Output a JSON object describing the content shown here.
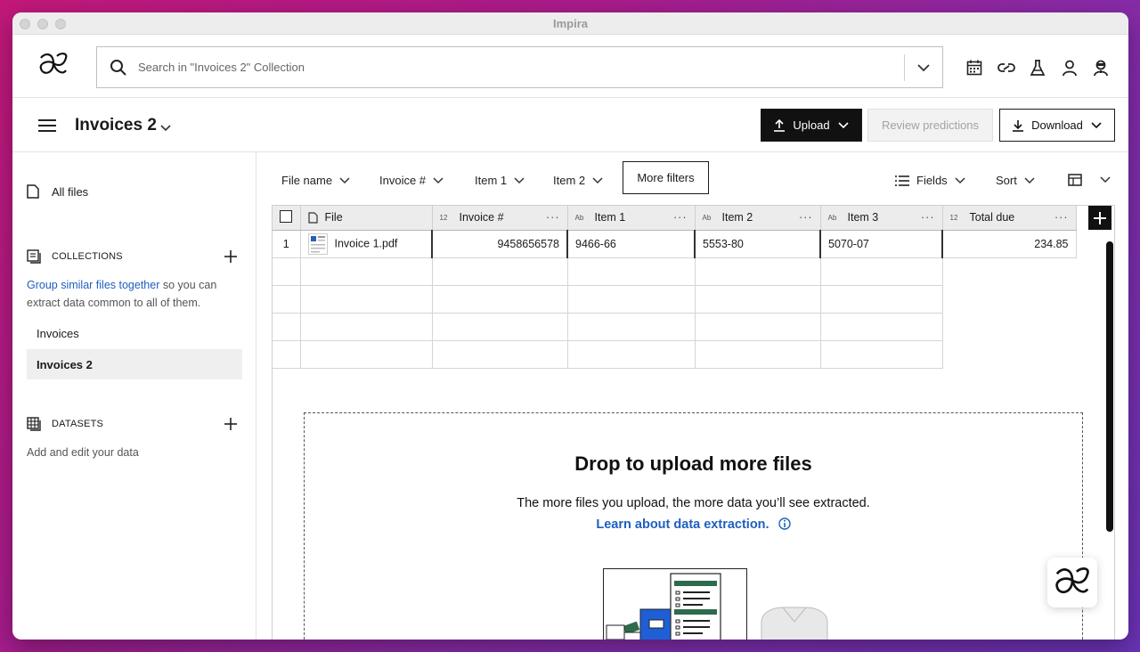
{
  "window": {
    "title": "Impira"
  },
  "search": {
    "placeholder": "Search in \"Invoices 2\" Collection"
  },
  "toolbar_icons": [
    "calendar-icon",
    "link-icon",
    "flask-icon",
    "user-icon",
    "agent-icon"
  ],
  "collection": {
    "title": "Invoices 2"
  },
  "actions": {
    "upload": "Upload",
    "review": "Review predictions",
    "download": "Download"
  },
  "sidebar": {
    "all_files": "All files",
    "collections_label": "COLLECTIONS",
    "collections_help_link": "Group similar files together",
    "collections_help_rest": " so you can extract data common to all of them.",
    "items": [
      {
        "label": "Invoices",
        "active": false
      },
      {
        "label": "Invoices 2",
        "active": true
      }
    ],
    "datasets_label": "DATASETS",
    "datasets_help": "Add and edit your data"
  },
  "filters": {
    "file_name": "File name",
    "invoice": "Invoice #",
    "item1": "Item 1",
    "item2": "Item 2",
    "more": "More filters",
    "fields": "Fields",
    "sort": "Sort"
  },
  "table": {
    "columns": [
      {
        "label": "File",
        "type": ""
      },
      {
        "label": "Invoice #",
        "type": "12"
      },
      {
        "label": "Item 1",
        "type": "Ab"
      },
      {
        "label": "Item 2",
        "type": "Ab"
      },
      {
        "label": "Item 3",
        "type": "Ab"
      },
      {
        "label": "Total due",
        "type": "12"
      }
    ],
    "rows": [
      {
        "num": "1",
        "file": "Invoice 1.pdf",
        "invoice": "9458656578",
        "item1": "9466-66",
        "item2": "5553-80",
        "item3": "5070-07",
        "total": "234.85"
      }
    ]
  },
  "dropzone": {
    "title": "Drop to upload more files",
    "subtitle": "The more files you upload, the more data you’ll see extracted.",
    "link": "Learn about data extraction."
  },
  "colors": {
    "accent_link": "#1f5fbf",
    "primary_button": "#111111",
    "illus_green": "#2e6b4b",
    "illus_blue": "#1f5fd6"
  }
}
